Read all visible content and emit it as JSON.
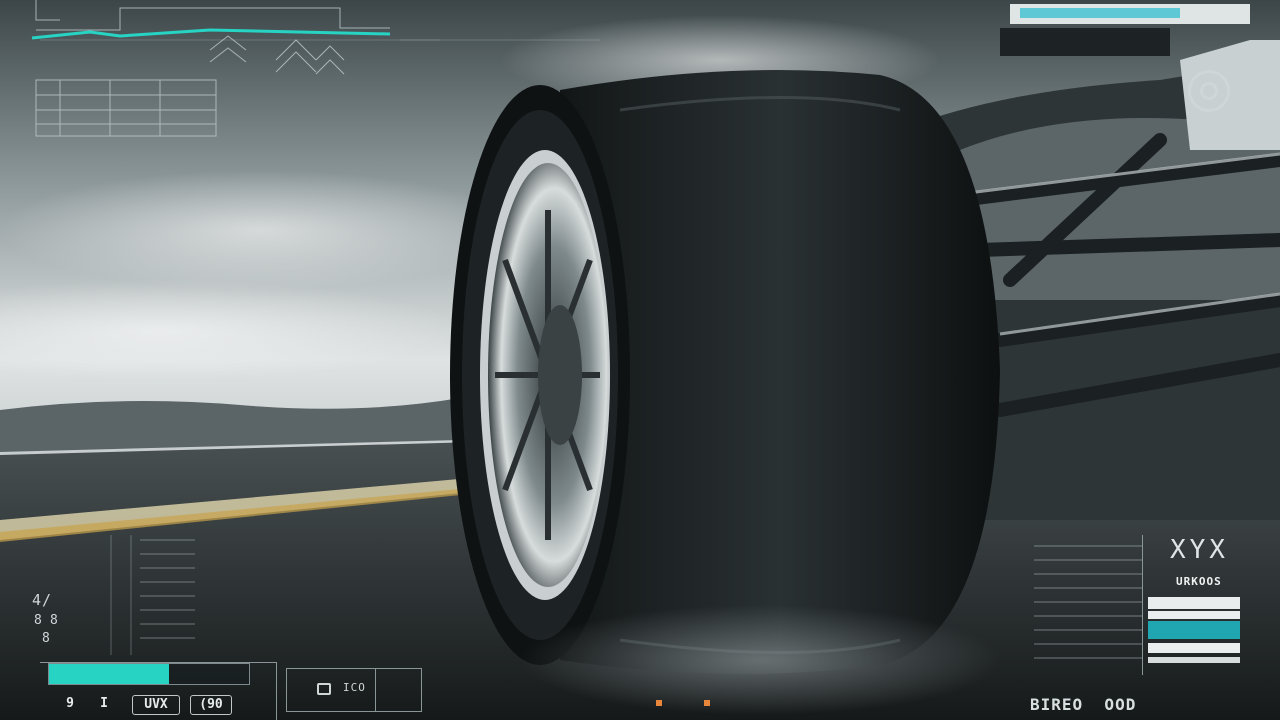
{
  "colors": {
    "accent": "#27d3c3",
    "accent_soft": "#5ec8d4",
    "hud_line": "#b9c4c7",
    "highlight": "#e8873b"
  },
  "top_right_panel": {
    "icons": [
      "target-ring-icon"
    ]
  },
  "left_readout": {
    "glyph_labels": [
      "4/",
      "8",
      "8",
      "8"
    ]
  },
  "bottom_left_panel": {
    "bar_fill": 0.6,
    "chips": [
      "9",
      "I",
      "UVX",
      "(90"
    ]
  },
  "bottom_center_panel": {
    "icons": [
      "square-icon"
    ],
    "label": "ICO"
  },
  "bottom_right_panel": {
    "header_glyph": "XYX",
    "title": "URKOOS",
    "footer": "BIREO  OOD"
  }
}
